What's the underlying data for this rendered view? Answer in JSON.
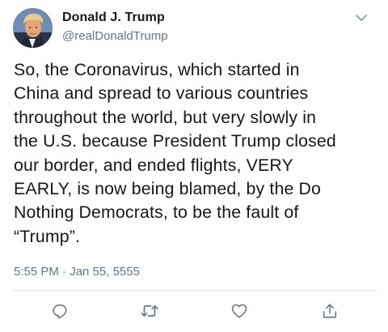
{
  "author": {
    "name": "Donald J. Trump",
    "handle": "@realDonaldTrump",
    "avatar_icon": "profile-photo"
  },
  "tweet": {
    "text": "So, the Coronavirus, which started in\nChina and spread to various countries\nthroughout the world, but very slowly in\nthe U.S. because President Trump closed\nour border, and ended flights, VERY\nEARLY, is now being blamed, by the Do\nNothing Democrats, to be the fault of\n“Trump”.",
    "timestamp": "5:55 PM · Jan 55, 5555"
  },
  "actions": [
    {
      "name": "reply",
      "icon": "reply-icon"
    },
    {
      "name": "retweet",
      "icon": "retweet-icon"
    },
    {
      "name": "like",
      "icon": "heart-icon"
    },
    {
      "name": "share",
      "icon": "share-icon"
    }
  ],
  "colors": {
    "text": "#14171a",
    "secondary": "#657786",
    "divider": "#e1e8ed",
    "icon": "#657786"
  }
}
